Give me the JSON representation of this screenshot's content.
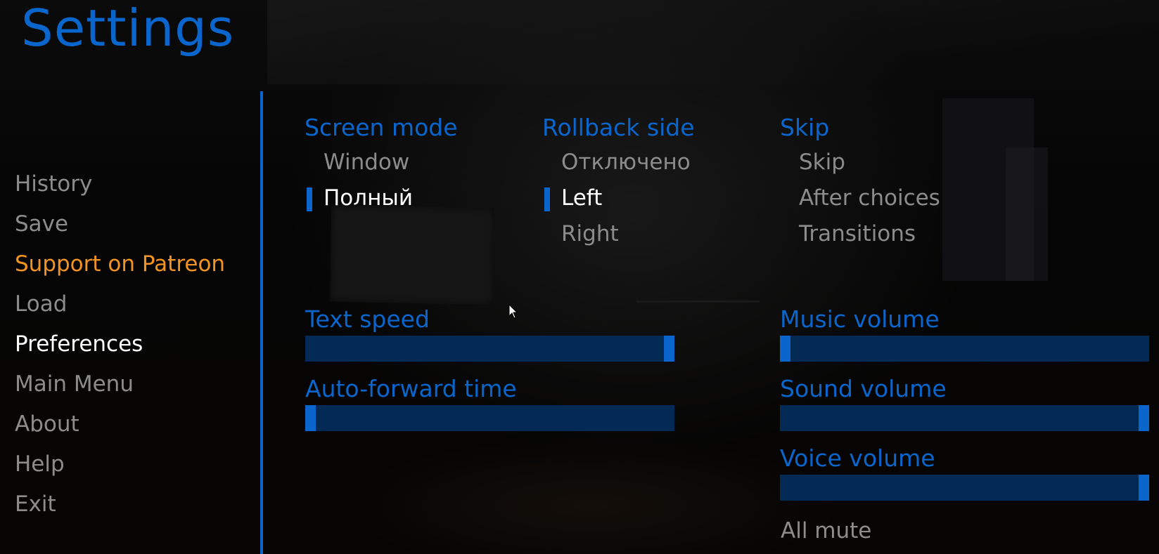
{
  "title": "Settings",
  "nav": {
    "items": [
      {
        "label": "History",
        "state": "normal"
      },
      {
        "label": "Save",
        "state": "normal"
      },
      {
        "label": "Support on Patreon",
        "state": "accent"
      },
      {
        "label": "Load",
        "state": "normal"
      },
      {
        "label": "Preferences",
        "state": "selected"
      },
      {
        "label": "Main Menu",
        "state": "normal"
      },
      {
        "label": "About",
        "state": "normal"
      },
      {
        "label": "Help",
        "state": "normal"
      },
      {
        "label": "Exit",
        "state": "normal"
      }
    ]
  },
  "screen_mode": {
    "label": "Screen mode",
    "options": [
      {
        "label": "Window",
        "selected": false
      },
      {
        "label": "Полный",
        "selected": true
      }
    ]
  },
  "rollback_side": {
    "label": "Rollback side",
    "options": [
      {
        "label": "Отключено",
        "selected": false
      },
      {
        "label": "Left",
        "selected": true
      },
      {
        "label": "Right",
        "selected": false
      }
    ]
  },
  "skip": {
    "label": "Skip",
    "options": [
      {
        "label": "Skip",
        "selected": false
      },
      {
        "label": "After choices",
        "selected": false
      },
      {
        "label": "Transitions",
        "selected": false
      }
    ]
  },
  "sliders": {
    "text_speed": {
      "label": "Text speed",
      "value": 1.0
    },
    "auto_forward_time": {
      "label": "Auto-forward time",
      "value": 0.0
    },
    "music_volume": {
      "label": "Music volume",
      "value": 0.0
    },
    "sound_volume": {
      "label": "Sound volume",
      "value": 1.0
    },
    "voice_volume": {
      "label": "Voice volume",
      "value": 1.0
    }
  },
  "all_mute": {
    "label": "All mute"
  },
  "colors": {
    "accent": "#0a66cc",
    "track": "#022a55",
    "selected_text": "#ffffff",
    "idle_text": "#8c8c8c",
    "highlight": "#f39321"
  }
}
